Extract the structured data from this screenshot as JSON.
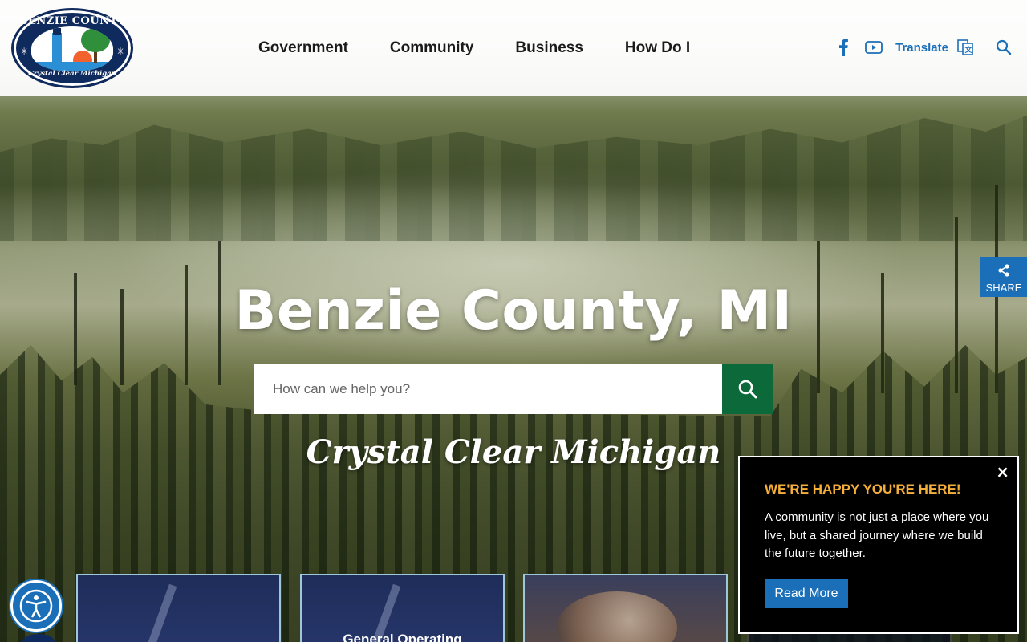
{
  "logo": {
    "top_text": "BENZIE COUNTY",
    "bottom_text": "Crystal Clear Michigan"
  },
  "nav": {
    "items": [
      {
        "label": "Government"
      },
      {
        "label": "Community"
      },
      {
        "label": "Business"
      },
      {
        "label": "How Do I"
      }
    ]
  },
  "tools": {
    "facebook_icon": "facebook-icon",
    "youtube_icon": "youtube-icon",
    "translate_label": "Translate",
    "translate_icon": "translate-icon",
    "search_icon": "search-icon"
  },
  "hero": {
    "title": "Benzie County, MI",
    "search_placeholder": "How can we help you?",
    "tagline": "Crystal Clear Michigan"
  },
  "share": {
    "label": "SHARE"
  },
  "cards": [
    {
      "title": ""
    },
    {
      "title": "General Operating"
    },
    {
      "title": ""
    },
    {
      "title": ""
    }
  ],
  "popup": {
    "heading": "WE'RE HAPPY YOU'RE HERE!",
    "text": "A community is not just a place where you live, but a shared journey where we build the future together.",
    "button_label": "Read More",
    "close_symbol": "×"
  },
  "colors": {
    "accent_blue": "#1b6fb8",
    "search_green": "#0c6a3a",
    "popup_heading": "#f5b03a",
    "logo_navy": "#0f2a5c"
  }
}
